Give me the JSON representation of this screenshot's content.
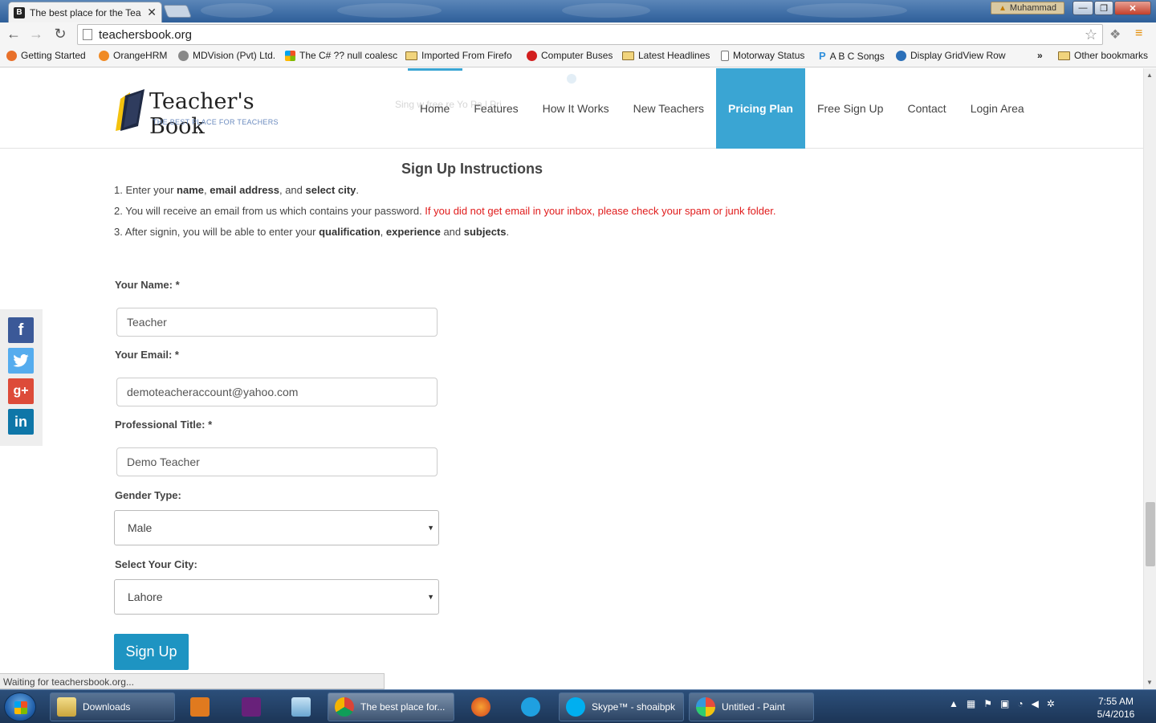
{
  "browser": {
    "tab_title": "The best place for the Tea",
    "tab_favicon": "B",
    "user_name": "Muhammad",
    "url": "teachersbook.org",
    "status_text": "Waiting for teachersbook.org..."
  },
  "bookmarks": [
    {
      "label": "Getting Started",
      "icon": "firefox-icon",
      "color": "#e8702a"
    },
    {
      "label": "OrangeHRM",
      "icon": "orangehrm-icon",
      "color": "#f08a24"
    },
    {
      "label": "MDVision (Pvt) Ltd.",
      "icon": "mdvision-icon",
      "color": "#888888"
    },
    {
      "label": "The C# ?? null coalesc",
      "icon": "windows-icon",
      "color": "#3c8d2f"
    },
    {
      "label": "Imported From Firefo",
      "icon": "folder-icon",
      "color": "#f1d47d"
    },
    {
      "label": "Computer Buses",
      "icon": "question-icon",
      "color": "#d21f1f"
    },
    {
      "label": "Latest Headlines",
      "icon": "folder-icon",
      "color": "#f1d47d"
    },
    {
      "label": "Motorway Status",
      "icon": "page-icon",
      "color": "#ffffff"
    },
    {
      "label": "A B C Songs",
      "icon": "p-icon",
      "color": "#2f8fdc"
    },
    {
      "label": "Display GridView Row",
      "icon": "asp-icon",
      "color": "#2a6fb8"
    }
  ],
  "bookmarks_overflow": "»",
  "other_bookmarks": "Other bookmarks",
  "site": {
    "logo_text": "Teacher's Book",
    "logo_tagline": "THE BEST PLACE FOR TEACHERS",
    "ghost_text": "Sing         w free        re Yo    Pa          l Pri",
    "nav": [
      "Home",
      "Features",
      "How It Works",
      "New Teachers",
      "Pricing Plan",
      "Free Sign Up",
      "Contact",
      "Login Area"
    ],
    "active_nav": "Pricing Plan"
  },
  "instructions": {
    "title": "Sign Up Instructions",
    "line1": {
      "a": "1. Enter your ",
      "b": "name",
      "c": ", ",
      "d": "email address",
      "e": ", and ",
      "f": "select city",
      "g": "."
    },
    "line2": {
      "a": "2. You will receive an email from us which contains your password. ",
      "warn": "If you did not get email in your inbox, please check your spam or junk folder."
    },
    "line3": {
      "a": "3. After signin, you will be able to enter your ",
      "b": "qualification",
      "c": ", ",
      "d": "experience",
      "e": " and ",
      "f": "subjects",
      "g": "."
    }
  },
  "form": {
    "name_label": "Your Name: *",
    "name_value": "Teacher",
    "email_label": "Your Email: *",
    "email_value": "demoteacheraccount@yahoo.com",
    "title_label": "Professional Title: *",
    "title_value": "Demo Teacher",
    "gender_label": "Gender Type:",
    "gender_value": "Male",
    "city_label": "Select Your City:",
    "city_value": "Lahore",
    "submit_label": "Sign Up"
  },
  "social": [
    {
      "name": "facebook",
      "glyph": "f",
      "color": "#3b5998"
    },
    {
      "name": "twitter",
      "glyph": "t",
      "color": "#55acee"
    },
    {
      "name": "googleplus",
      "glyph": "g+",
      "color": "#dd4b39"
    },
    {
      "name": "linkedin",
      "glyph": "in",
      "color": "#0e76a8"
    }
  ],
  "taskbar": {
    "downloads": "Downloads",
    "chrome": "The best place for...",
    "skype": "Skype™ - shoaibpk",
    "paint": "Untitled - Paint",
    "time": "7:55 AM",
    "date": "5/4/2016"
  }
}
